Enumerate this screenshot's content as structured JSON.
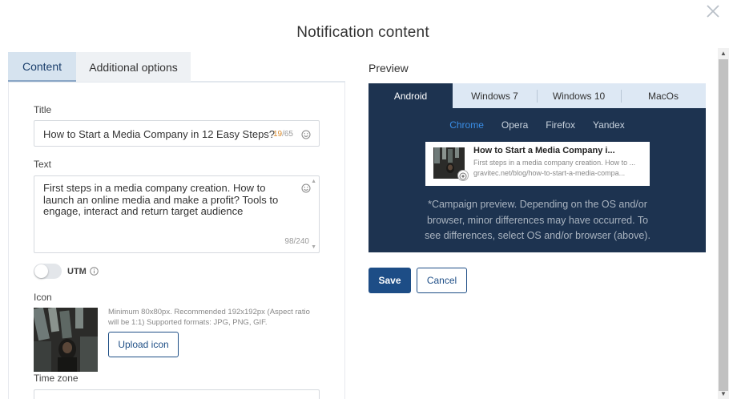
{
  "modal": {
    "title": "Notification content"
  },
  "left_tabs": [
    {
      "label": "Content",
      "active": true
    },
    {
      "label": "Additional options",
      "active": false
    }
  ],
  "form": {
    "title_label": "Title",
    "title_value": "How to Start a Media Company in 12 Easy Steps?",
    "title_count_current": "19",
    "title_count_max": "/65",
    "text_label": "Text",
    "text_value": "First steps in a media company creation. How to launch an online media and make a profit? Tools to engage, interact and return target audience",
    "text_count": "98/240",
    "utm_label": "UTM",
    "utm_enabled": false,
    "icon_label": "Icon",
    "icon_note": "Minimum 80x80px. Recommended 192x192px (Aspect ratio will be 1:1) Supported formats: JPG, PNG, GIF.",
    "upload_label": "Upload icon",
    "timezone_label": "Time zone"
  },
  "preview": {
    "label": "Preview",
    "os_tabs": [
      {
        "label": "Android",
        "active": true
      },
      {
        "label": "Windows 7",
        "active": false
      },
      {
        "label": "Windows 10",
        "active": false
      },
      {
        "label": "MacOs",
        "active": false
      }
    ],
    "browser_tabs": [
      {
        "label": "Chrome",
        "active": true
      },
      {
        "label": "Opera",
        "active": false
      },
      {
        "label": "Firefox",
        "active": false
      },
      {
        "label": "Yandex",
        "active": false
      }
    ],
    "notification": {
      "title": "How to Start a Media Company i...",
      "text": "First steps in a media company creation. How to ...",
      "url": "gravitec.net/blog/how-to-start-a-media-compa..."
    },
    "note": "*Campaign preview. Depending on the OS and/or browser, minor differences may have occurred. To see differences, select OS and/or browser (above)."
  },
  "actions": {
    "save": "Save",
    "cancel": "Cancel"
  },
  "colors": {
    "primary": "#1d4d86",
    "preview_bg": "#1d3350",
    "active_browser": "#3a8ee6",
    "counter_accent": "#d98a2b"
  }
}
